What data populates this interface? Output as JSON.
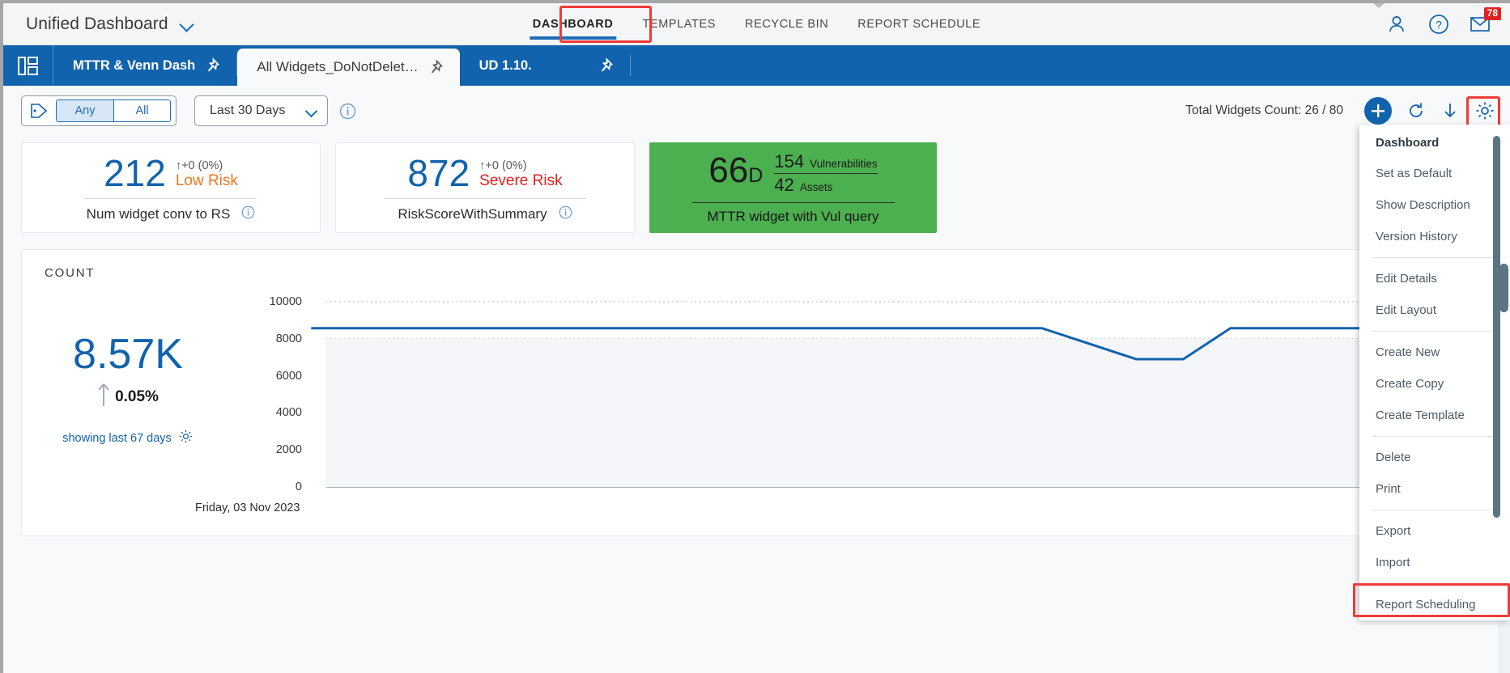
{
  "header": {
    "brand_title": "Unified Dashboard",
    "brand_chevron_icon": "chevron-down-icon",
    "nav": [
      {
        "label": "DASHBOARD",
        "active": true
      },
      {
        "label": "TEMPLATES",
        "active": false
      },
      {
        "label": "RECYCLE BIN",
        "active": false
      },
      {
        "label": "REPORT SCHEDULE",
        "active": false
      }
    ],
    "icons": {
      "user": "user-icon",
      "help": "help-circle-icon",
      "mail": "envelope-icon"
    },
    "mail_badge": "78"
  },
  "tabs": {
    "grid_icon": "dashboard-grid-icon",
    "items": [
      {
        "label": "MTTR & Venn Dash",
        "active": false,
        "pin_icon": "pin-icon"
      },
      {
        "label": "All Widgets_DoNotDelet…",
        "active": true,
        "pin_icon": "pin-icon"
      },
      {
        "label": "UD 1.10.",
        "active": false,
        "pin_icon": "pin-icon"
      }
    ]
  },
  "toolbar": {
    "tag_icon": "tag-icon",
    "segments": [
      {
        "label": "Any",
        "selected": true
      },
      {
        "label": "All",
        "selected": false
      }
    ],
    "date_range": "Last 30 Days",
    "date_chevron_icon": "chevron-down-icon",
    "info_icon": "info-circle-icon",
    "widgets_count": "Total Widgets Count: 26 / 80",
    "add_icon": "plus-icon",
    "refresh_icon": "refresh-icon",
    "download_icon": "download-icon",
    "settings_icon": "gear-icon"
  },
  "kpis": [
    {
      "value": "212",
      "delta": "↑+0 (0%)",
      "risk_label": "Low Risk",
      "risk_color": "#ef7622",
      "title": "Num widget conv to RS",
      "info_icon": "info-circle-icon"
    },
    {
      "value": "872",
      "delta": "↑+0 (0%)",
      "risk_label": "Severe Risk",
      "risk_color": "#e02020",
      "title": "RiskScoreWithSummary",
      "info_icon": "info-circle-icon"
    }
  ],
  "mttr_widget": {
    "value": "66",
    "unit": "D",
    "numerator": "154",
    "numerator_label": "Vulnerabilities",
    "denominator": "42",
    "denominator_label": "Assets",
    "title": "MTTR widget with Vul query",
    "background_color": "#4caf50"
  },
  "chart_card": {
    "heading": "COUNT",
    "big_value": "8.57K",
    "trend_arrow_icon": "arrow-up-icon",
    "trend_pct": "0.05%",
    "showing_text": "showing last 67 days",
    "showing_gear_icon": "gear-icon"
  },
  "chart_data": {
    "type": "line",
    "title": "COUNT",
    "xlabel": "",
    "ylabel": "",
    "ylim": [
      0,
      10000
    ],
    "yticks": [
      0,
      2000,
      4000,
      6000,
      8000,
      10000
    ],
    "ytick_labels": [
      "0",
      "2000",
      "4000",
      "6000",
      "8000",
      "10000"
    ],
    "xtick_labels": [
      "Friday, 03 Nov 2023"
    ],
    "grid": true,
    "legend": false,
    "line_color": "#1263ad",
    "fill_color": "#f4f6f9",
    "series": [
      {
        "name": "Count",
        "x": [
          0,
          55,
          62,
          70,
          74,
          78,
          100
        ],
        "values": [
          8570,
          8570,
          8570,
          6900,
          6900,
          8570,
          8570
        ]
      }
    ]
  },
  "menu": {
    "title": "Dashboard",
    "groups": [
      [
        "Set as Default",
        "Show Description",
        "Version History"
      ],
      [
        "Edit Details",
        "Edit Layout"
      ],
      [
        "Create New",
        "Create Copy",
        "Create Template"
      ],
      [
        "Delete",
        "Print"
      ],
      [
        "Export",
        "Import"
      ],
      [
        "Report Scheduling"
      ]
    ],
    "highlighted_item": "Report Scheduling"
  },
  "highlight_color": "#ef3b38"
}
